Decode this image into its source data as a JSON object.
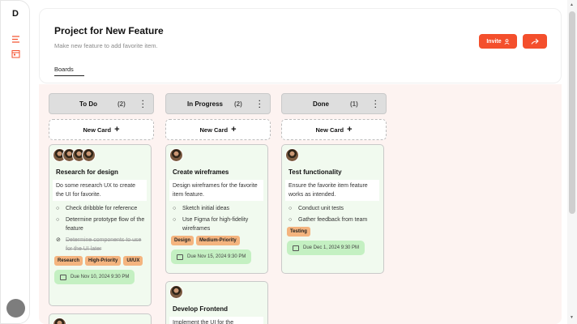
{
  "app": {
    "logo": "D"
  },
  "sidebar": {
    "icons": [
      "menu-icon",
      "calendar-icon"
    ]
  },
  "header": {
    "title": "Project for New Feature",
    "subtitle": "Make new feature to add favorite item.",
    "tab": "Boards",
    "invite_label": "Invite",
    "colors": {
      "accent": "#f44f2c"
    }
  },
  "columns": [
    {
      "title": "To Do",
      "count": "(2)",
      "new_card_label": "New Card",
      "cards": [
        {
          "title": "Research for design",
          "description": "Do some research UX to create the UI for favorite.",
          "checklist": [
            {
              "text": "Check dribbble for reference",
              "done": false
            },
            {
              "text": "Determine prototype flow of the feature",
              "done": false
            },
            {
              "text": "Determine components to use for the UI later",
              "done": true
            }
          ],
          "tags": [
            "Research",
            "High-Priority",
            "UI/UX"
          ],
          "due": "Due Nov 10, 2024 9:30 PM"
        }
      ]
    },
    {
      "title": "In Progress",
      "count": "(2)",
      "new_card_label": "New Card",
      "cards": [
        {
          "title": "Create wireframes",
          "description": "Design wireframes for the favorite item feature.",
          "checklist": [
            {
              "text": "Sketch initial ideas",
              "done": false
            },
            {
              "text": "Use Figma for high-fidelity wireframes",
              "done": false
            }
          ],
          "tags": [
            "Design",
            "Medium-Priority"
          ],
          "due": "Due Nov 15, 2024 9:30 PM"
        },
        {
          "title": "Develop Frontend",
          "description": "Implement the UI for the"
        }
      ]
    },
    {
      "title": "Done",
      "count": "(1)",
      "new_card_label": "New Card",
      "cards": [
        {
          "title": "Test functionality",
          "description": "Ensure the favorite item feature works as intended.",
          "checklist": [
            {
              "text": "Conduct unit tests",
              "done": false
            },
            {
              "text": "Gather feedback from team",
              "done": false
            }
          ],
          "tags": [
            "Testing"
          ],
          "due": "Due Dec 1, 2024 9:30 PM"
        }
      ]
    }
  ]
}
